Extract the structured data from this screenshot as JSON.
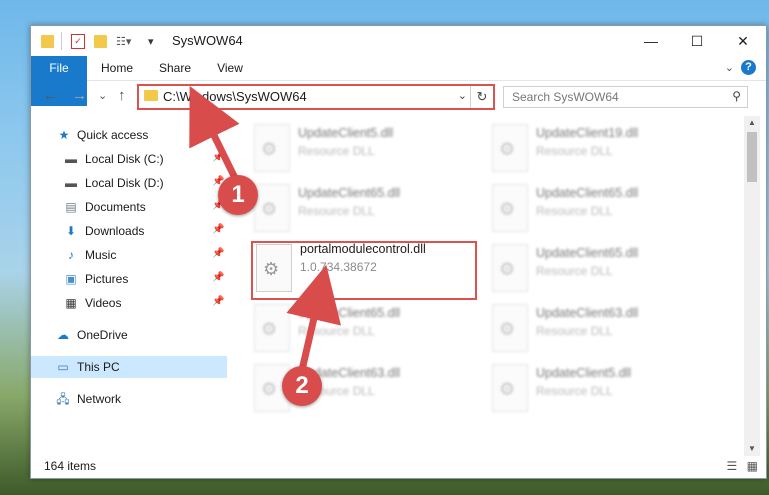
{
  "titlebar": {
    "title": "SysWOW64",
    "minimize": "—",
    "maximize": "☐",
    "close": "✕"
  },
  "ribbon": {
    "tabs": [
      "File",
      "Home",
      "Share",
      "View"
    ],
    "help": "?"
  },
  "nav": {
    "back": "←",
    "forward": "→",
    "recent": "⌄",
    "up": "↑",
    "address": "C:\\Windows\\SysWOW64",
    "search_placeholder": "Search SysWOW64"
  },
  "sidebar": {
    "items": [
      {
        "label": "Quick access",
        "icon": "star-icon",
        "pinned": false
      },
      {
        "label": "Local Disk (C:)",
        "icon": "drive-icon",
        "pinned": true
      },
      {
        "label": "Local Disk (D:)",
        "icon": "drive-icon",
        "pinned": true
      },
      {
        "label": "Documents",
        "icon": "documents-icon",
        "pinned": true
      },
      {
        "label": "Downloads",
        "icon": "download-icon",
        "pinned": true
      },
      {
        "label": "Music",
        "icon": "music-icon",
        "pinned": true
      },
      {
        "label": "Pictures",
        "icon": "pictures-icon",
        "pinned": true
      },
      {
        "label": "Videos",
        "icon": "videos-icon",
        "pinned": true
      },
      {
        "label": "OneDrive",
        "icon": "cloud-icon",
        "pinned": false
      },
      {
        "label": "This PC",
        "icon": "computer-icon",
        "pinned": false
      },
      {
        "label": "Network",
        "icon": "network-icon",
        "pinned": false
      }
    ]
  },
  "files": [
    {
      "name": "UpdateClient5.dll",
      "sub": "Resource DLL"
    },
    {
      "name": "UpdateClient19.dll",
      "sub": "Resource DLL"
    },
    {
      "name": "UpdateClient65.dll",
      "sub": "Resource DLL"
    },
    {
      "name": "UpdateClient65.dll",
      "sub": "Resource DLL"
    },
    {
      "name": "portalmodulecontrol.dll",
      "sub": "1.0.734.38672"
    },
    {
      "name": "UpdateClient65.dll",
      "sub": "Resource DLL"
    },
    {
      "name": "UpdateClient65.dll",
      "sub": "Resource DLL"
    },
    {
      "name": "UpdateClient63.dll",
      "sub": "Resource DLL"
    },
    {
      "name": "UpdateClient63.dll",
      "sub": "Resource DLL"
    },
    {
      "name": "UpdateClient5.dll",
      "sub": "Resource DLL"
    }
  ],
  "status": {
    "count": "164 items"
  },
  "markers": [
    "1",
    "2"
  ],
  "colors": {
    "accent": "#1979ca",
    "highlight": "#d9534f",
    "selected": "#cce8ff"
  }
}
